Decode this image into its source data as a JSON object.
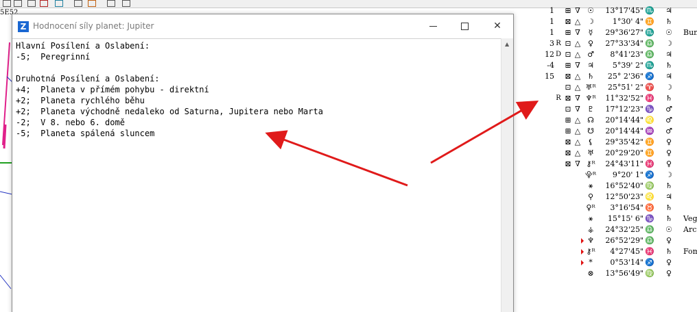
{
  "corner_label": "5E52",
  "window": {
    "title": "Hodnocení síly planet: Jupiter",
    "icon_letter": "Z",
    "lines": [
      "Hlavní Posílení a Oslabení:",
      "-5;  Peregrinní",
      "",
      "Druhotná Posílení a Oslabení:",
      "+4;  Planeta v přímém pohybu - direktní",
      "+2;  Planeta rychlého běhu",
      "+2;  Planeta východně nedaleko od Saturna, Jupitera nebo Marta",
      "-2;  V 8. nebo 6. domě",
      "-5;  Planeta spálená sluncem"
    ]
  },
  "table": {
    "rows": [
      {
        "num": "1",
        "rd": "",
        "box": "⊞",
        "asp": "∇",
        "planet": "☉",
        "degree": "13°17'45\"",
        "sign": "♏",
        "ruler": "♃",
        "star": ""
      },
      {
        "num": "1",
        "rd": "",
        "box": "⊠",
        "asp": "△",
        "planet": "☽",
        "degree": "1°30' 4\"",
        "sign": "♊",
        "ruler": "♄",
        "star": ""
      },
      {
        "num": "1",
        "rd": "",
        "box": "⊞",
        "asp": "∇",
        "planet": "☿",
        "degree": "29°36'27\"",
        "sign": "♏",
        "ruler": "☉",
        "star": "Bun"
      },
      {
        "num": "3",
        "rd": "R",
        "box": "⊡",
        "asp": "△",
        "planet": "♀",
        "degree": "27°33'34\"",
        "sign": "♎",
        "ruler": "☽",
        "star": ""
      },
      {
        "num": "12",
        "rd": "D",
        "box": "⊡",
        "asp": "△",
        "planet": "♂",
        "degree": "8°41'23\"",
        "sign": "♎",
        "ruler": "♃",
        "star": ""
      },
      {
        "num": "-4",
        "rd": "",
        "box": "⊞",
        "asp": "∇",
        "planet": "♃",
        "degree": "5°39' 2\"",
        "sign": "♏",
        "ruler": "♄",
        "star": ""
      },
      {
        "num": "15",
        "rd": "",
        "box": "⊠",
        "asp": "△",
        "planet": "♄",
        "degree": "25° 2'36\"",
        "sign": "♐",
        "ruler": "♃",
        "star": ""
      },
      {
        "num": "",
        "rd": "",
        "box": "⊡",
        "asp": "△",
        "planet": "♅ᴿ",
        "degree": "25°51' 2\"",
        "sign": "♈",
        "ruler": "☽",
        "star": ""
      },
      {
        "num": "",
        "rd": "R",
        "box": "⊠",
        "asp": "∇",
        "planet": "♆ᴿ",
        "degree": "11°32'52\"",
        "sign": "♓",
        "ruler": "♄",
        "star": ""
      },
      {
        "num": "",
        "rd": "",
        "box": "⊡",
        "asp": "∇",
        "planet": "♇",
        "degree": "17°12'23\"",
        "sign": "♑",
        "ruler": "♂",
        "star": ""
      },
      {
        "num": "",
        "rd": "",
        "box": "⊞",
        "asp": "△",
        "planet": "☊",
        "degree": "20°14'44\"",
        "sign": "♌",
        "ruler": "♂",
        "star": ""
      },
      {
        "num": "",
        "rd": "",
        "box": "⊞",
        "asp": "△",
        "planet": "☋",
        "degree": "20°14'44\"",
        "sign": "♒",
        "ruler": "♂",
        "star": ""
      },
      {
        "num": "",
        "rd": "",
        "box": "⊠",
        "asp": "△",
        "planet": "⚸",
        "degree": "29°35'42\"",
        "sign": "♊",
        "ruler": "♀",
        "star": ""
      },
      {
        "num": "",
        "rd": "",
        "box": "⊠",
        "asp": "△",
        "planet": "♅",
        "degree": "20°29'20\"",
        "sign": "♊",
        "ruler": "♀",
        "star": ""
      },
      {
        "num": "",
        "rd": "",
        "box": "⊠",
        "asp": "∇",
        "planet": "⚷ᴿ",
        "degree": "24°43'11\"",
        "sign": "♓",
        "ruler": "♀",
        "star": ""
      },
      {
        "num": "",
        "rd": "",
        "box": "",
        "asp": "",
        "planet": "⯓ᴿ",
        "degree": "9°20' 1\"",
        "sign": "♐",
        "ruler": "☽",
        "star": ""
      },
      {
        "num": "",
        "rd": "",
        "box": "",
        "asp": "",
        "planet": "⚹",
        "degree": "16°52'40\"",
        "sign": "♍",
        "ruler": "♄",
        "star": ""
      },
      {
        "num": "",
        "rd": "",
        "box": "",
        "asp": "",
        "planet": "⚲",
        "degree": "12°50'23\"",
        "sign": "♌",
        "ruler": "♃",
        "star": ""
      },
      {
        "num": "",
        "rd": "",
        "box": "",
        "asp": "",
        "planet": "♀ᴿ",
        "degree": "3°16'54\"",
        "sign": "♉",
        "ruler": "♄",
        "star": ""
      },
      {
        "num": "",
        "rd": "",
        "box": "",
        "asp": "",
        "planet": "⚹",
        "degree": "15°15' 6\"",
        "sign": "♑",
        "ruler": "♄",
        "star": "Veg"
      },
      {
        "num": "",
        "rd": "",
        "box": "",
        "asp": "",
        "planet": "⚶",
        "degree": "24°32'25\"",
        "sign": "♎",
        "ruler": "☉",
        "star": "Arc"
      },
      {
        "num": "",
        "rd": "",
        "box": "",
        "asp": "",
        "planet": "♆",
        "degree": "26°52'29\"",
        "sign": "♎",
        "ruler": "♀",
        "star": "",
        "marker": true
      },
      {
        "num": "",
        "rd": "",
        "box": "",
        "asp": "",
        "planet": "⚷ᴿ",
        "degree": "4°27'45\"",
        "sign": "♓",
        "ruler": "♄",
        "star": "Fom",
        "marker": true
      },
      {
        "num": "",
        "rd": "",
        "box": "",
        "asp": "",
        "planet": "*",
        "degree": "0°53'14\"",
        "sign": "♐",
        "ruler": "♀",
        "star": "",
        "marker": true
      },
      {
        "num": "",
        "rd": "",
        "box": "",
        "asp": "",
        "planet": "⊗",
        "degree": "13°56'49\"",
        "sign": "♍",
        "ruler": "♀",
        "star": ""
      }
    ]
  },
  "colors": {
    "arrow": "#e01a1a",
    "app_icon": "#1a67d2",
    "title_text": "#7a7a7a"
  }
}
